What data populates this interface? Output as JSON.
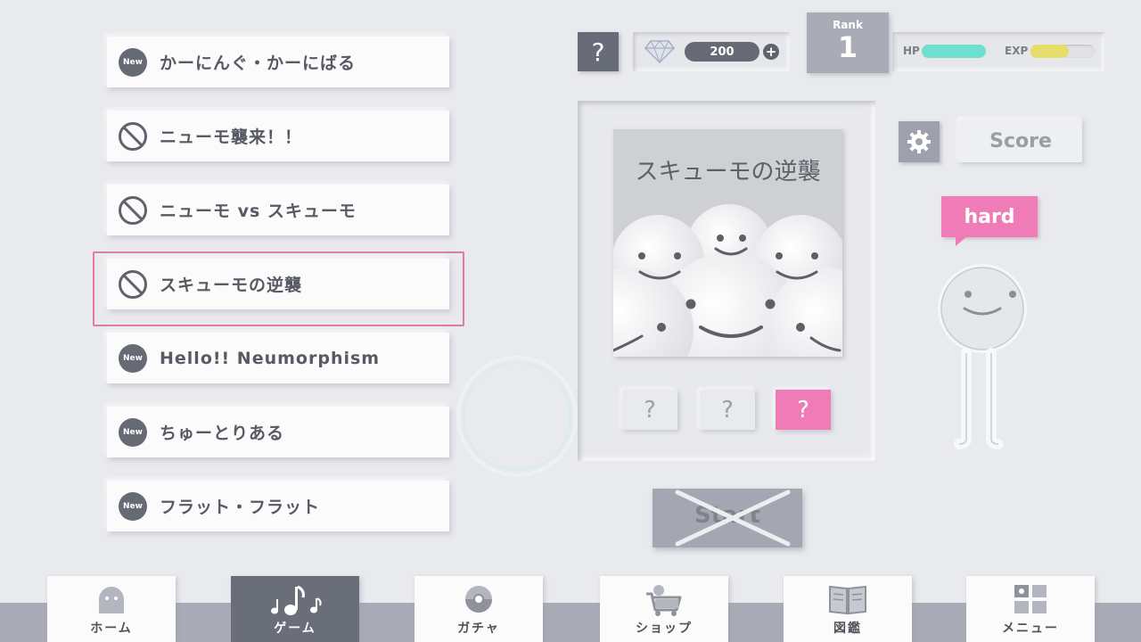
{
  "songs": [
    {
      "badge": "New",
      "title": "かーにんぐ・かーにばる",
      "locked": false
    },
    {
      "badge": "",
      "title": "ニューモ襲来！！",
      "locked": true
    },
    {
      "badge": "",
      "title": "ニューモ vs スキューモ",
      "locked": true
    },
    {
      "badge": "",
      "title": "スキューモの逆襲",
      "locked": true,
      "selected": true
    },
    {
      "badge": "New",
      "title": "Hello!! Neumorphism",
      "locked": false
    },
    {
      "badge": "New",
      "title": "ちゅーとりある",
      "locked": false
    },
    {
      "badge": "New",
      "title": "フラット・フラット",
      "locked": false
    }
  ],
  "status": {
    "help_label": "?",
    "gems": "200",
    "gem_add": "+",
    "rank_label": "Rank",
    "rank_value": "1",
    "hp_label": "HP",
    "hp_ratio": 1.0,
    "exp_label": "EXP",
    "exp_ratio": 0.6,
    "hp_color": "#6fe0cf",
    "exp_color": "#e6dc6a"
  },
  "jacket": {
    "title": "スキューモの逆襲"
  },
  "difficulty_buttons": [
    {
      "label": "?",
      "active": false
    },
    {
      "label": "?",
      "active": false
    },
    {
      "label": "?",
      "active": true
    }
  ],
  "start_label": "Start",
  "score_label": "Score",
  "difficulty": "hard",
  "nav": [
    {
      "label": "ホーム",
      "icon": "home-icon",
      "active": false
    },
    {
      "label": "ゲーム",
      "icon": "music-notes-icon",
      "active": true
    },
    {
      "label": "ガチャ",
      "icon": "capsule-icon",
      "active": false
    },
    {
      "label": "ショップ",
      "icon": "cart-icon",
      "active": false
    },
    {
      "label": "図鑑",
      "icon": "book-icon",
      "active": false
    },
    {
      "label": "メニュー",
      "icon": "grid-icon",
      "active": false
    }
  ],
  "colors": {
    "accent_pink": "#ef7cb6",
    "selection_border": "#e07aa8",
    "dark": "#666a74",
    "background": "#e9eaee"
  }
}
